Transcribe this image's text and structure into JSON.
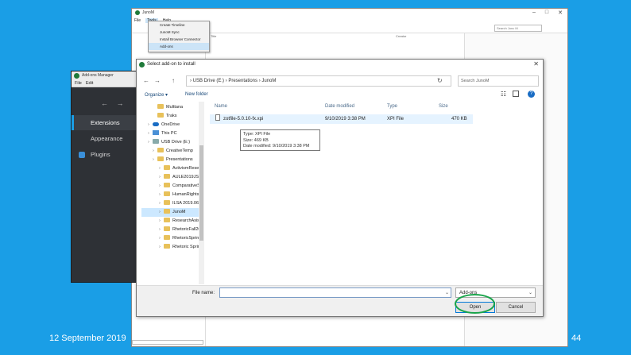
{
  "bg_window": {
    "title": "JunoM",
    "menu": [
      "File",
      "Tools",
      "Help"
    ],
    "active_menu": "Tools",
    "search_placeholder": "Search Junc M",
    "col_title": "Title",
    "col_creator": "Creator",
    "win_min": "–",
    "win_max": "□",
    "win_close": "✕"
  },
  "tools_menu": [
    "Create Timeline",
    "JunoM Sync",
    "Install Browser Connector",
    "Add-ons"
  ],
  "addons_manager": {
    "title": "Add-ons Manager",
    "menu": [
      "File",
      "Edit"
    ],
    "nav": "← →",
    "items": [
      "Extensions",
      "Appearance",
      "Plugins"
    ],
    "selected": "Extensions"
  },
  "dialog": {
    "title": "Select add-on to install",
    "close": "✕",
    "nav_back": "←",
    "nav_forward": "→",
    "nav_up": "↑",
    "refresh": "↻",
    "path": "›  USB Drive (E:)  ›  Presentations  ›  JunoM",
    "search_placeholder": "Search JunoM",
    "organize": "Organize ▾",
    "new_folder": "New folder",
    "help": "?",
    "tree": [
      {
        "label": "Multtana",
        "kind": "folder",
        "indent": 1
      },
      {
        "label": "Traks",
        "kind": "folder",
        "indent": 1
      },
      {
        "label": "OneDrive",
        "kind": "cloud",
        "indent": 0
      },
      {
        "label": "This PC",
        "kind": "pc",
        "indent": 0
      },
      {
        "label": "USB Drive (E:)",
        "kind": "drive",
        "indent": 0
      },
      {
        "label": "CreativeTemp",
        "kind": "folder",
        "indent": 1
      },
      {
        "label": "Presentations",
        "kind": "folder",
        "indent": 1
      },
      {
        "label": "ActivismResear",
        "kind": "folder",
        "indent": 2
      },
      {
        "label": "AULE2019JSA",
        "kind": "folder",
        "indent": 2
      },
      {
        "label": "ComparativeSch",
        "kind": "folder",
        "indent": 2
      },
      {
        "label": "HumanRightsCl",
        "kind": "folder",
        "indent": 2
      },
      {
        "label": "ILSA 2019.06.07",
        "kind": "folder",
        "indent": 2
      },
      {
        "label": "JunoM",
        "kind": "folder",
        "indent": 2,
        "selected": true
      },
      {
        "label": "ResearchAsist",
        "kind": "folder",
        "indent": 2
      },
      {
        "label": "RhetoricFall201",
        "kind": "folder",
        "indent": 2
      },
      {
        "label": "RhetoricSpring",
        "kind": "folder",
        "indent": 2
      },
      {
        "label": "Rhetoric Spring",
        "kind": "folder",
        "indent": 2
      }
    ],
    "columns": {
      "name": "Name",
      "date": "Date modified",
      "type": "Type",
      "size": "Size"
    },
    "file": {
      "name": "zotfile-5.0.10-fx.xpi",
      "date": "9/10/2019 3:38 PM",
      "type": "XPI File",
      "size": "470 KB"
    },
    "tooltip": [
      "Type: XPI File",
      "Size: 469 KB",
      "Date modified: 9/10/2019 3:38 PM"
    ],
    "filename_label": "File name:",
    "filename_value": "",
    "filetype": "Add-ons",
    "open_button": "Open",
    "cancel_button": "Cancel"
  },
  "footer": {
    "date": "12 September 2019",
    "page_number": "44"
  },
  "colors": {
    "slide_bg": "#1a9ee6",
    "highlight_circle": "#19a44a",
    "addons_bg": "#2e3136"
  }
}
